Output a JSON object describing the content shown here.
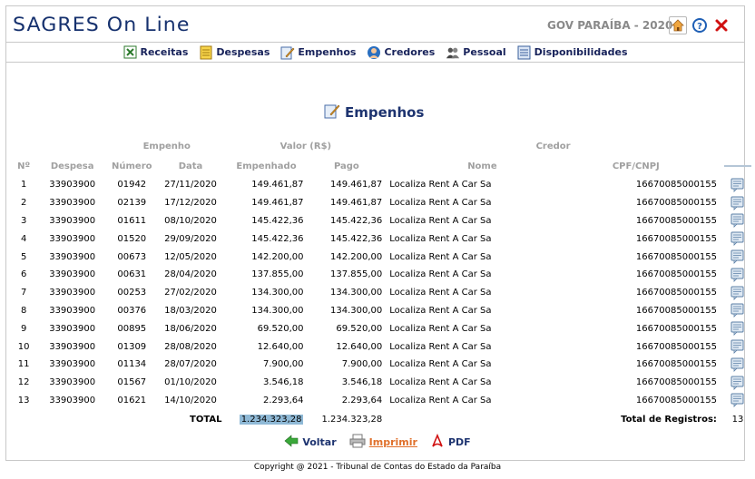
{
  "header": {
    "logo": "SAGRES On Line",
    "gov_label": "GOV PARAÍBA - 2020",
    "icons": [
      "home-icon",
      "help-icon",
      "close-icon"
    ]
  },
  "menu": [
    {
      "label": "Receitas",
      "icon": "receitas-icon"
    },
    {
      "label": "Despesas",
      "icon": "despesas-icon"
    },
    {
      "label": "Empenhos",
      "icon": "empenhos-icon"
    },
    {
      "label": "Credores",
      "icon": "credores-icon"
    },
    {
      "label": "Pessoal",
      "icon": "pessoal-icon"
    },
    {
      "label": "Disponibilidades",
      "icon": "disponibilidades-icon"
    }
  ],
  "page_title": "Empenhos",
  "table": {
    "group_headers": {
      "empenho": "Empenho",
      "valor": "Valor (R$)",
      "credor": "Credor"
    },
    "columns": [
      "Nº",
      "Despesa",
      "Número",
      "Data",
      "Empenhado",
      "Pago",
      "Nome",
      "CPF/CNPJ"
    ],
    "rows": [
      [
        "1",
        "33903900",
        "01942",
        "27/11/2020",
        "149.461,87",
        "149.461,87",
        "Localiza Rent A Car Sa",
        "16670085000155"
      ],
      [
        "2",
        "33903900",
        "02139",
        "17/12/2020",
        "149.461,87",
        "149.461,87",
        "Localiza Rent A Car Sa",
        "16670085000155"
      ],
      [
        "3",
        "33903900",
        "01611",
        "08/10/2020",
        "145.422,36",
        "145.422,36",
        "Localiza Rent A Car Sa",
        "16670085000155"
      ],
      [
        "4",
        "33903900",
        "01520",
        "29/09/2020",
        "145.422,36",
        "145.422,36",
        "Localiza Rent A Car Sa",
        "16670085000155"
      ],
      [
        "5",
        "33903900",
        "00673",
        "12/05/2020",
        "142.200,00",
        "142.200,00",
        "Localiza Rent A Car Sa",
        "16670085000155"
      ],
      [
        "6",
        "33903900",
        "00631",
        "28/04/2020",
        "137.855,00",
        "137.855,00",
        "Localiza Rent A Car Sa",
        "16670085000155"
      ],
      [
        "7",
        "33903900",
        "00253",
        "27/02/2020",
        "134.300,00",
        "134.300,00",
        "Localiza Rent A Car Sa",
        "16670085000155"
      ],
      [
        "8",
        "33903900",
        "00376",
        "18/03/2020",
        "134.300,00",
        "134.300,00",
        "Localiza Rent A Car Sa",
        "16670085000155"
      ],
      [
        "9",
        "33903900",
        "00895",
        "18/06/2020",
        "69.520,00",
        "69.520,00",
        "Localiza Rent A Car Sa",
        "16670085000155"
      ],
      [
        "10",
        "33903900",
        "01309",
        "28/08/2020",
        "12.640,00",
        "12.640,00",
        "Localiza Rent A Car Sa",
        "16670085000155"
      ],
      [
        "11",
        "33903900",
        "01134",
        "28/07/2020",
        "7.900,00",
        "7.900,00",
        "Localiza Rent A Car Sa",
        "16670085000155"
      ],
      [
        "12",
        "33903900",
        "01567",
        "01/10/2020",
        "3.546,18",
        "3.546,18",
        "Localiza Rent A Car Sa",
        "16670085000155"
      ],
      [
        "13",
        "33903900",
        "01621",
        "14/10/2020",
        "2.293,64",
        "2.293,64",
        "Localiza Rent A Car Sa",
        "16670085000155"
      ]
    ],
    "total_label": "TOTAL",
    "total_empenhado": "1.234.323,28",
    "total_pago": "1.234.323,28",
    "registros_label": "Total de Registros:",
    "registros_count": "13"
  },
  "footer": {
    "voltar": "Voltar",
    "imprimir": "Imprimir",
    "pdf": "PDF",
    "copyright": "Copyright @ 2021 - Tribunal de Contas do Estado da Paraíba"
  },
  "colors": {
    "brand": "#16316e",
    "accent": "#e0702b",
    "highlight": "#8fb9d6"
  }
}
